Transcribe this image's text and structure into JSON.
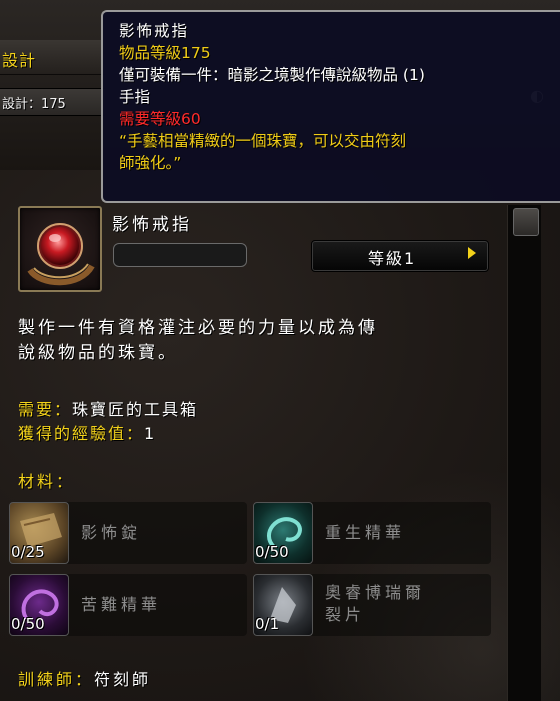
{
  "window": {
    "title": "設計",
    "skill_label": "設計：175"
  },
  "tooltip": {
    "item_name": "影怖戒指",
    "item_level": "物品等級175",
    "unique_line": "僅可裝備一件：暗影之境製作傳說級物品 (1)",
    "slot": "手指",
    "required_level": "需要等級60",
    "flavor_line1": "“手藝相當精緻的一個珠寶，可以交由符刻",
    "flavor_line2": "師強化。”"
  },
  "recipe": {
    "name": "影怖戒指",
    "rank_label": "等級1",
    "description_line1": "製作一件有資格灌注必要的力量以成為傳",
    "description_line2": "說級物品的珠寶。",
    "requires_label": "需要：",
    "requires_value": "珠寶匠的工具箱",
    "exp_label": "獲得的經驗值：",
    "exp_value": "1",
    "materials_label": "材料：",
    "trainer_label": "訓練師：",
    "trainer_value": "符刻師"
  },
  "materials": [
    {
      "name": "影怖錠",
      "count": "0/25",
      "icon": "ingot-icon"
    },
    {
      "name": "重生精華",
      "count": "0/50",
      "icon": "rebirth-essence-icon"
    },
    {
      "name": "苦難精華",
      "count": "0/50",
      "icon": "suffering-essence-icon"
    },
    {
      "name_line1": "奧睿博瑞爾",
      "name_line2": "裂片",
      "count": "0/1",
      "icon": "shard-icon"
    }
  ],
  "colors": {
    "gold": "#f3d21a",
    "required_red": "#ff2a2a",
    "tooltip_bg": "#0c0c22",
    "muted_text": "#8d8d8d"
  }
}
